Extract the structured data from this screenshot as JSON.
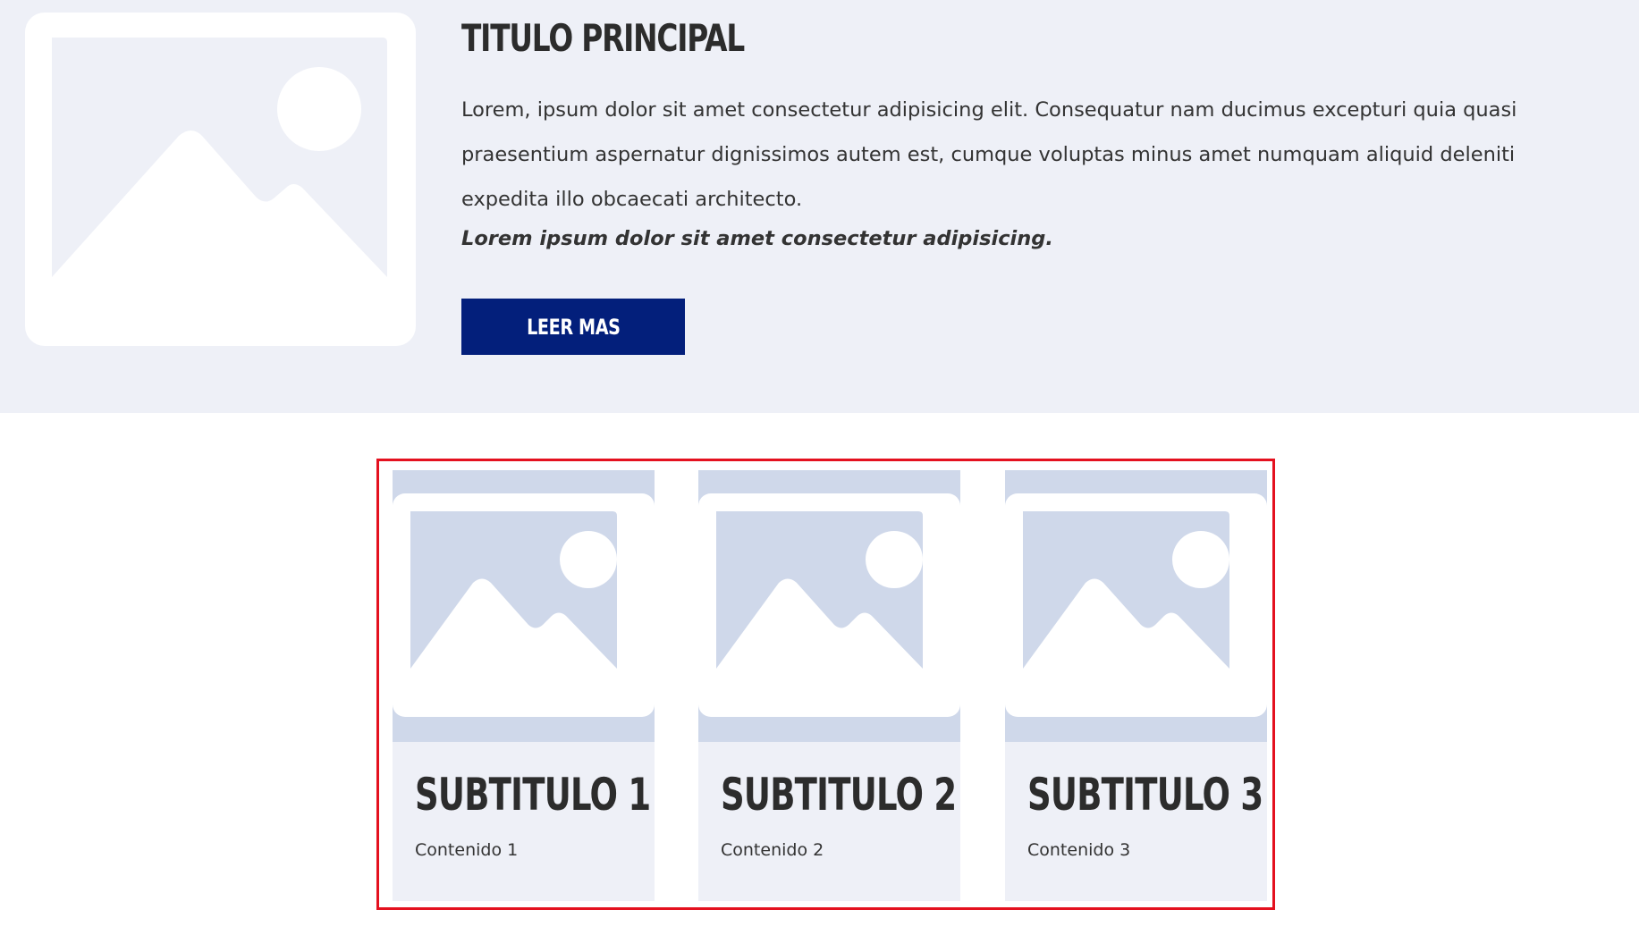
{
  "hero": {
    "image_icon": "image-placeholder-icon",
    "title": "TITULO PRINCIPAL",
    "body": "Lorem, ipsum dolor sit amet consectetur adipisicing elit. Consequatur nam ducimus excepturi quia quasi praesentium aspernatur dignissimos autem est, cumque voluptas minus amet numquam aliquid deleniti expedita illo obcaecati architecto.",
    "emphasis": "Lorem ipsum dolor sit amet consectetur adipisicing.",
    "button_label": "LEER MAS"
  },
  "cards": [
    {
      "title": "SUBTITULO 1",
      "text": "Contenido 1",
      "image_icon": "image-placeholder-icon"
    },
    {
      "title": "SUBTITULO 2",
      "text": "Contenido 2",
      "image_icon": "image-placeholder-icon"
    },
    {
      "title": "SUBTITULO 3",
      "text": "Contenido 3",
      "image_icon": "image-placeholder-icon"
    }
  ],
  "colors": {
    "hero_background": "#eef0f7",
    "button_background": "#031f7b",
    "card_background": "#eef0f7",
    "card_image_background": "#cfd8ea",
    "highlight_border": "#e4111f"
  }
}
